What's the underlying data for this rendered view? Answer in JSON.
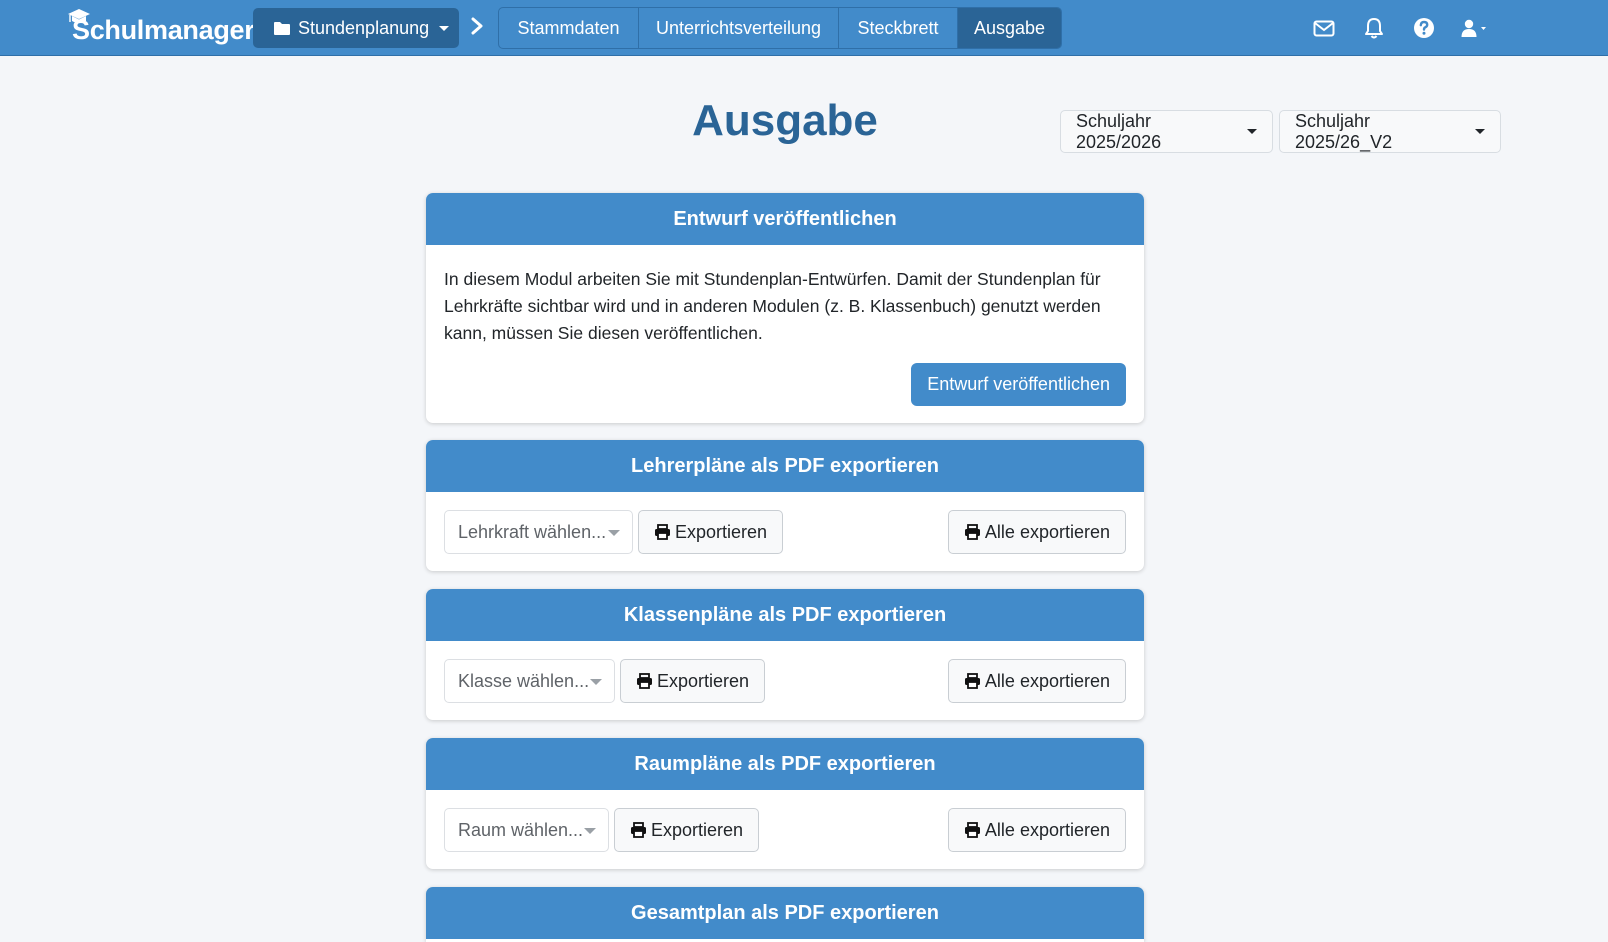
{
  "brand": {
    "name": "Schulmanager"
  },
  "module": {
    "label": "Stundenplanung"
  },
  "tabs": [
    {
      "label": "Stammdaten",
      "active": false
    },
    {
      "label": "Unterrichtsverteilung",
      "active": false
    },
    {
      "label": "Steckbrett",
      "active": false
    },
    {
      "label": "Ausgabe",
      "active": true
    }
  ],
  "nav_icons": [
    "mail-icon",
    "bell-icon",
    "help-icon",
    "user-icon"
  ],
  "page": {
    "title": "Ausgabe"
  },
  "year_selector": {
    "school_year": "Schuljahr 2025/2026",
    "version": "Schuljahr 2025/26_V2"
  },
  "cards": {
    "publish": {
      "title": "Entwurf veröffentlichen",
      "text_lines": [
        "In diesem Modul arbeiten Sie mit Stundenplan-Entwürfen. Damit der Stundenplan für",
        "Lehrkräfte sichtbar wird und in anderen Modulen (z. B. Klassenbuch) genutzt werden",
        "kann, müssen Sie diesen veröffentlichen."
      ],
      "button": "Entwurf veröffentlichen"
    },
    "teachers": {
      "title": "Lehrerpläne als PDF exportieren",
      "select_placeholder": "Lehrkraft wählen...",
      "export": "Exportieren",
      "export_all": "Alle exportieren"
    },
    "classes": {
      "title": "Klassenpläne als PDF exportieren",
      "select_placeholder": "Klasse wählen...",
      "export": "Exportieren",
      "export_all": "Alle exportieren"
    },
    "rooms": {
      "title": "Raumpläne als PDF exportieren",
      "select_placeholder": "Raum wählen...",
      "export": "Exportieren",
      "export_all": "Alle exportieren"
    },
    "overall": {
      "title": "Gesamtplan als PDF exportieren"
    }
  },
  "colors": {
    "navbar": "#428bca",
    "navbar_active": "#2a6496",
    "title": "#2a6496",
    "card_header": "#428bca"
  }
}
